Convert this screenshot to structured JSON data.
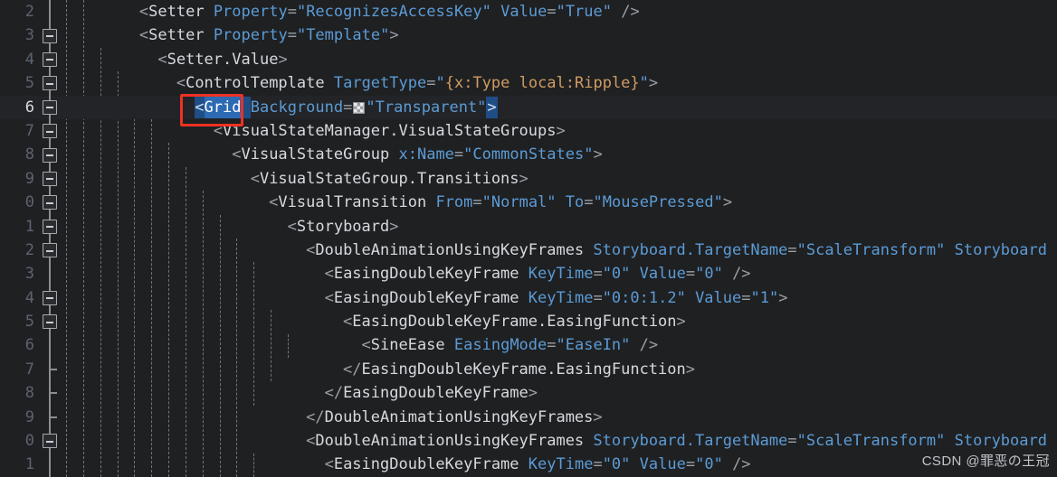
{
  "editor": {
    "language": "XAML",
    "background_color": "#1f2022",
    "current_line": 6,
    "watermark": "CSDN @罪恶の王冠",
    "annotation": {
      "shape": "rectangle",
      "color": "#ee3124",
      "target": "Grid"
    },
    "selection": {
      "text": "Grid",
      "color": "#2d6ab4"
    },
    "swatch_value": "Transparent"
  },
  "lines": [
    {
      "number": "2",
      "fold": "none",
      "indent_guides": 2,
      "tokens": [
        {
          "t": "        ",
          "c": "plain"
        },
        {
          "t": "<",
          "c": "brk"
        },
        {
          "t": "Setter",
          "c": "tag"
        },
        {
          "t": " ",
          "c": "plain"
        },
        {
          "t": "Property",
          "c": "attr"
        },
        {
          "t": "=",
          "c": "eq"
        },
        {
          "t": "\"RecognizesAccessKey\"",
          "c": "str"
        },
        {
          "t": " ",
          "c": "plain"
        },
        {
          "t": "Value",
          "c": "attr"
        },
        {
          "t": "=",
          "c": "eq"
        },
        {
          "t": "\"True\"",
          "c": "str"
        },
        {
          "t": " ",
          "c": "plain"
        },
        {
          "t": "/>",
          "c": "brk"
        }
      ]
    },
    {
      "number": "3",
      "fold": "box",
      "indent_guides": 2,
      "tokens": [
        {
          "t": "        ",
          "c": "plain"
        },
        {
          "t": "<",
          "c": "brk"
        },
        {
          "t": "Setter",
          "c": "tag"
        },
        {
          "t": " ",
          "c": "plain"
        },
        {
          "t": "Property",
          "c": "attr"
        },
        {
          "t": "=",
          "c": "eq"
        },
        {
          "t": "\"Template\"",
          "c": "str"
        },
        {
          "t": ">",
          "c": "brk"
        }
      ]
    },
    {
      "number": "4",
      "fold": "box",
      "indent_guides": 3,
      "tokens": [
        {
          "t": "          ",
          "c": "plain"
        },
        {
          "t": "<",
          "c": "brk"
        },
        {
          "t": "Setter.Value",
          "c": "tag"
        },
        {
          "t": ">",
          "c": "brk"
        }
      ]
    },
    {
      "number": "5",
      "fold": "box",
      "indent_guides": 4,
      "tokens": [
        {
          "t": "            ",
          "c": "plain"
        },
        {
          "t": "<",
          "c": "brk"
        },
        {
          "t": "ControlTemplate",
          "c": "tag"
        },
        {
          "t": " ",
          "c": "plain"
        },
        {
          "t": "TargetType",
          "c": "attr"
        },
        {
          "t": "=",
          "c": "eq"
        },
        {
          "t": "\"",
          "c": "q"
        },
        {
          "t": "{x:Type local:Ripple}",
          "c": "markup"
        },
        {
          "t": "\"",
          "c": "q"
        },
        {
          "t": ">",
          "c": "brk"
        }
      ]
    },
    {
      "number": "6",
      "fold": "box",
      "current": true,
      "indent_guides": 5,
      "tokens": [
        {
          "t": "              ",
          "c": "plain"
        },
        {
          "t": "<",
          "c": "sel-lt"
        },
        {
          "t": "Grid",
          "c": "sel"
        },
        {
          "t": " ",
          "c": "sel-lt"
        },
        {
          "t": "Background",
          "c": "attr"
        },
        {
          "t": "=",
          "c": "eq"
        },
        {
          "t": "SWATCH",
          "c": "swatch"
        },
        {
          "t": "\"Transparent\"",
          "c": "str"
        },
        {
          "t": ">",
          "c": "brkmatch"
        }
      ]
    },
    {
      "number": "7",
      "fold": "box",
      "indent_guides": 6,
      "tokens": [
        {
          "t": "                ",
          "c": "plain"
        },
        {
          "t": "<",
          "c": "brk"
        },
        {
          "t": "VisualStateManager.VisualStateGroups",
          "c": "tag"
        },
        {
          "t": ">",
          "c": "brk"
        }
      ]
    },
    {
      "number": "8",
      "fold": "box",
      "indent_guides": 7,
      "tokens": [
        {
          "t": "                  ",
          "c": "plain"
        },
        {
          "t": "<",
          "c": "brk"
        },
        {
          "t": "VisualStateGroup",
          "c": "tag"
        },
        {
          "t": " ",
          "c": "plain"
        },
        {
          "t": "x:Name",
          "c": "attr"
        },
        {
          "t": "=",
          "c": "eq"
        },
        {
          "t": "\"CommonStates\"",
          "c": "str"
        },
        {
          "t": ">",
          "c": "brk"
        }
      ]
    },
    {
      "number": "9",
      "fold": "box",
      "indent_guides": 8,
      "tokens": [
        {
          "t": "                    ",
          "c": "plain"
        },
        {
          "t": "<",
          "c": "brk"
        },
        {
          "t": "VisualStateGroup.Transitions",
          "c": "tag"
        },
        {
          "t": ">",
          "c": "brk"
        }
      ]
    },
    {
      "number": "0",
      "fold": "box",
      "indent_guides": 9,
      "tokens": [
        {
          "t": "                      ",
          "c": "plain"
        },
        {
          "t": "<",
          "c": "brk"
        },
        {
          "t": "VisualTransition",
          "c": "tag"
        },
        {
          "t": " ",
          "c": "plain"
        },
        {
          "t": "From",
          "c": "attr"
        },
        {
          "t": "=",
          "c": "eq"
        },
        {
          "t": "\"Normal\"",
          "c": "str"
        },
        {
          "t": " ",
          "c": "plain"
        },
        {
          "t": "To",
          "c": "attr"
        },
        {
          "t": "=",
          "c": "eq"
        },
        {
          "t": "\"MousePressed\"",
          "c": "str"
        },
        {
          "t": ">",
          "c": "brk"
        }
      ]
    },
    {
      "number": "1",
      "fold": "box",
      "indent_guides": 10,
      "tokens": [
        {
          "t": "                        ",
          "c": "plain"
        },
        {
          "t": "<",
          "c": "brk"
        },
        {
          "t": "Storyboard",
          "c": "tag"
        },
        {
          "t": ">",
          "c": "brk"
        }
      ]
    },
    {
      "number": "2",
      "fold": "box",
      "indent_guides": 11,
      "tokens": [
        {
          "t": "                          ",
          "c": "plain"
        },
        {
          "t": "<",
          "c": "brk"
        },
        {
          "t": "DoubleAnimationUsingKeyFrames",
          "c": "tag"
        },
        {
          "t": " ",
          "c": "plain"
        },
        {
          "t": "Storyboard.TargetName",
          "c": "attr"
        },
        {
          "t": "=",
          "c": "eq"
        },
        {
          "t": "\"ScaleTransform\"",
          "c": "str"
        },
        {
          "t": " ",
          "c": "plain"
        },
        {
          "t": "Storyboard",
          "c": "attr"
        }
      ]
    },
    {
      "number": "3",
      "fold": "none",
      "indent_guides": 12,
      "tokens": [
        {
          "t": "                            ",
          "c": "plain"
        },
        {
          "t": "<",
          "c": "brk"
        },
        {
          "t": "EasingDoubleKeyFrame",
          "c": "tag"
        },
        {
          "t": " ",
          "c": "plain"
        },
        {
          "t": "KeyTime",
          "c": "attr"
        },
        {
          "t": "=",
          "c": "eq"
        },
        {
          "t": "\"0\"",
          "c": "str"
        },
        {
          "t": " ",
          "c": "plain"
        },
        {
          "t": "Value",
          "c": "attr"
        },
        {
          "t": "=",
          "c": "eq"
        },
        {
          "t": "\"0\"",
          "c": "str"
        },
        {
          "t": " ",
          "c": "plain"
        },
        {
          "t": "/>",
          "c": "brk"
        }
      ]
    },
    {
      "number": "4",
      "fold": "box",
      "indent_guides": 12,
      "tokens": [
        {
          "t": "                            ",
          "c": "plain"
        },
        {
          "t": "<",
          "c": "brk"
        },
        {
          "t": "EasingDoubleKeyFrame",
          "c": "tag"
        },
        {
          "t": " ",
          "c": "plain"
        },
        {
          "t": "KeyTime",
          "c": "attr"
        },
        {
          "t": "=",
          "c": "eq"
        },
        {
          "t": "\"0:0:1.2\"",
          "c": "str"
        },
        {
          "t": " ",
          "c": "plain"
        },
        {
          "t": "Value",
          "c": "attr"
        },
        {
          "t": "=",
          "c": "eq"
        },
        {
          "t": "\"1\"",
          "c": "str"
        },
        {
          "t": ">",
          "c": "brk"
        }
      ]
    },
    {
      "number": "5",
      "fold": "box",
      "indent_guides": 13,
      "tokens": [
        {
          "t": "                              ",
          "c": "plain"
        },
        {
          "t": "<",
          "c": "brk"
        },
        {
          "t": "EasingDoubleKeyFrame.EasingFunction",
          "c": "tag"
        },
        {
          "t": ">",
          "c": "brk"
        }
      ]
    },
    {
      "number": "6",
      "fold": "none",
      "indent_guides": 14,
      "tokens": [
        {
          "t": "                                ",
          "c": "plain"
        },
        {
          "t": "<",
          "c": "brk"
        },
        {
          "t": "SineEase",
          "c": "tag"
        },
        {
          "t": " ",
          "c": "plain"
        },
        {
          "t": "EasingMode",
          "c": "attr"
        },
        {
          "t": "=",
          "c": "eq"
        },
        {
          "t": "\"EaseIn\"",
          "c": "str"
        },
        {
          "t": " ",
          "c": "plain"
        },
        {
          "t": "/>",
          "c": "brk"
        }
      ]
    },
    {
      "number": "7",
      "fold": "endtick",
      "indent_guides": 13,
      "tokens": [
        {
          "t": "                              ",
          "c": "plain"
        },
        {
          "t": "</",
          "c": "brk"
        },
        {
          "t": "EasingDoubleKeyFrame.EasingFunction",
          "c": "tag"
        },
        {
          "t": ">",
          "c": "brk"
        }
      ]
    },
    {
      "number": "8",
      "fold": "endtick",
      "indent_guides": 12,
      "tokens": [
        {
          "t": "                            ",
          "c": "plain"
        },
        {
          "t": "</",
          "c": "brk"
        },
        {
          "t": "EasingDoubleKeyFrame",
          "c": "tag"
        },
        {
          "t": ">",
          "c": "brk"
        }
      ]
    },
    {
      "number": "9",
      "fold": "endtick",
      "indent_guides": 11,
      "tokens": [
        {
          "t": "                          ",
          "c": "plain"
        },
        {
          "t": "</",
          "c": "brk"
        },
        {
          "t": "DoubleAnimationUsingKeyFrames",
          "c": "tag"
        },
        {
          "t": ">",
          "c": "brk"
        }
      ]
    },
    {
      "number": "0",
      "fold": "box",
      "indent_guides": 11,
      "tokens": [
        {
          "t": "                          ",
          "c": "plain"
        },
        {
          "t": "<",
          "c": "brk"
        },
        {
          "t": "DoubleAnimationUsingKeyFrames",
          "c": "tag"
        },
        {
          "t": " ",
          "c": "plain"
        },
        {
          "t": "Storyboard.TargetName",
          "c": "attr"
        },
        {
          "t": "=",
          "c": "eq"
        },
        {
          "t": "\"ScaleTransform\"",
          "c": "str"
        },
        {
          "t": " ",
          "c": "plain"
        },
        {
          "t": "Storyboard",
          "c": "attr"
        }
      ]
    },
    {
      "number": "1",
      "fold": "none",
      "indent_guides": 12,
      "tokens": [
        {
          "t": "                            ",
          "c": "plain"
        },
        {
          "t": "<",
          "c": "brk"
        },
        {
          "t": "EasingDoubleKeyFrame",
          "c": "tag"
        },
        {
          "t": " ",
          "c": "plain"
        },
        {
          "t": "KeyTime",
          "c": "attr"
        },
        {
          "t": "=",
          "c": "eq"
        },
        {
          "t": "\"0\"",
          "c": "str"
        },
        {
          "t": " ",
          "c": "plain"
        },
        {
          "t": "Value",
          "c": "attr"
        },
        {
          "t": "=",
          "c": "eq"
        },
        {
          "t": "\"0\"",
          "c": "str"
        },
        {
          "t": " ",
          "c": "plain"
        },
        {
          "t": "/>",
          "c": "brk"
        }
      ]
    }
  ]
}
